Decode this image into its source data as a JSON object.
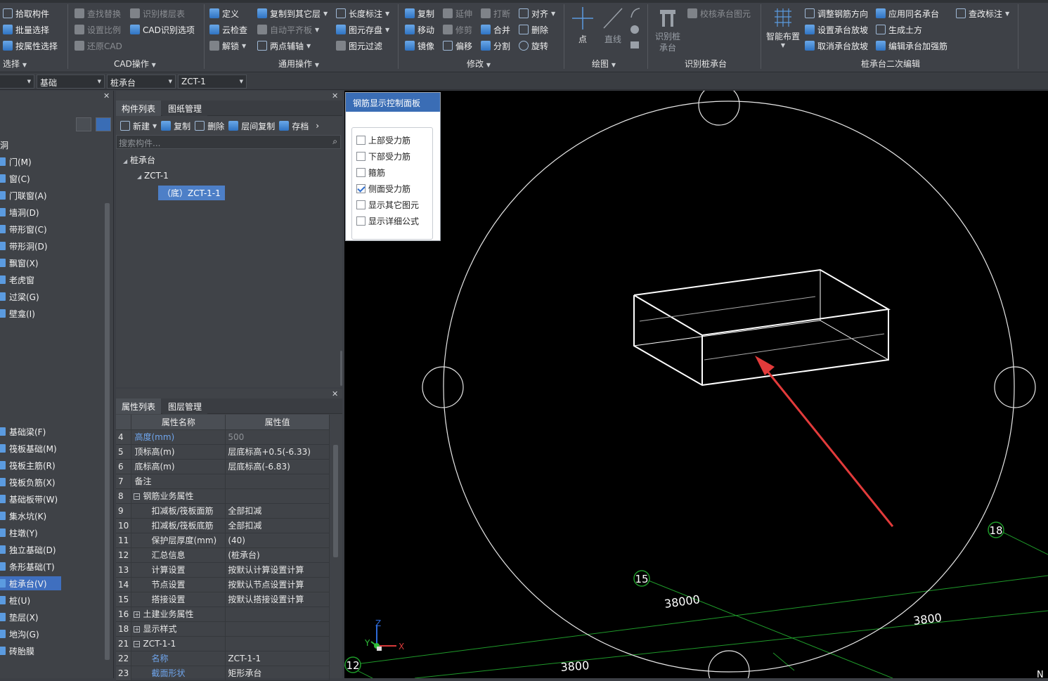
{
  "ribbon": {
    "select_group": {
      "items": [
        "拾取构件",
        "批量选择",
        "按属性选择"
      ],
      "label": "选择"
    },
    "cad_group": {
      "items": [
        "查找替换",
        "设置比例",
        "还原CAD",
        "识别楼层表",
        "CAD识别选项"
      ],
      "label": "CAD操作"
    },
    "general_group": {
      "items": [
        "定义",
        "云检查",
        "解锁",
        "复制到其它层",
        "自动平齐板",
        "两点辅轴",
        "长度标注",
        "图元存盘",
        "图元过滤"
      ],
      "label": "通用操作"
    },
    "modify_group": {
      "items": [
        "复制",
        "移动",
        "镜像",
        "延伸",
        "修剪",
        "偏移",
        "打断",
        "合并",
        "分割",
        "对齐",
        "删除",
        "旋转"
      ],
      "label": "修改"
    },
    "draw_group": {
      "items": [
        "点",
        "直线"
      ],
      "label": "绘图"
    },
    "identify_group": {
      "items": [
        "识别桩承台",
        "校核承台图元"
      ],
      "label": "识别桩承台"
    },
    "edit_group": {
      "items": [
        "智能布置",
        "调整钢筋方向",
        "设置承台放坡",
        "取消承台放坡",
        "应用同名承台",
        "生成土方",
        "编辑承台加强筋",
        "查改标注"
      ],
      "label": "桩承台二次编辑"
    }
  },
  "layerbar": {
    "combo1": "",
    "combo2": "基础",
    "combo3": "桩承台",
    "combo4": "ZCT-1"
  },
  "leftnav": {
    "header": "洞",
    "items": [
      "门(M)",
      "窗(C)",
      "门联窗(A)",
      "墙洞(D)",
      "带形窗(C)",
      "带形洞(D)",
      "飘窗(X)",
      "老虎窗",
      "过梁(G)",
      "壁龛(I)"
    ],
    "items2": [
      "基础梁(F)",
      "筏板基础(M)",
      "筏板主筋(R)",
      "筏板负筋(X)",
      "基础板带(W)",
      "集水坑(K)",
      "柱墩(Y)",
      "独立基础(D)",
      "条形基础(T)",
      "桩承台(V)",
      "桩(U)",
      "垫层(X)",
      "地沟(G)",
      "砖胎膜"
    ],
    "selected": "桩承台(V)"
  },
  "component_panel": {
    "tabs": [
      "构件列表",
      "图纸管理"
    ],
    "tools": [
      "新建",
      "复制",
      "删除",
      "层间复制",
      "存档"
    ],
    "search_placeholder": "搜索构件...",
    "tree": {
      "root": "桩承台",
      "child": "ZCT-1",
      "leaf": "（底）ZCT-1-1"
    }
  },
  "property_panel": {
    "tabs": [
      "属性列表",
      "图层管理"
    ],
    "col_name": "属性名称",
    "col_value": "属性值",
    "rows": [
      {
        "num": "4",
        "name": "高度(mm)",
        "value": "500",
        "style": "blue",
        "vstyle": "gray",
        "indent": 0,
        "pm": ""
      },
      {
        "num": "5",
        "name": "顶标高(m)",
        "value": "层底标高+0.5(-6.33)",
        "style": "",
        "vstyle": "",
        "indent": 0,
        "pm": ""
      },
      {
        "num": "6",
        "name": "底标高(m)",
        "value": "层底标高(-6.83)",
        "style": "",
        "vstyle": "",
        "indent": 0,
        "pm": ""
      },
      {
        "num": "7",
        "name": "备注",
        "value": "",
        "style": "",
        "vstyle": "",
        "indent": 0,
        "pm": ""
      },
      {
        "num": "8",
        "name": "钢筋业务属性",
        "value": "",
        "style": "",
        "vstyle": "",
        "indent": 0,
        "pm": "−"
      },
      {
        "num": "9",
        "name": "扣减板/筏板面筋",
        "value": "全部扣减",
        "style": "",
        "vstyle": "",
        "indent": 1,
        "pm": ""
      },
      {
        "num": "10",
        "name": "扣减板/筏板底筋",
        "value": "全部扣减",
        "style": "",
        "vstyle": "",
        "indent": 1,
        "pm": ""
      },
      {
        "num": "11",
        "name": "保护层厚度(mm)",
        "value": "(40)",
        "style": "",
        "vstyle": "",
        "indent": 1,
        "pm": ""
      },
      {
        "num": "12",
        "name": "汇总信息",
        "value": "(桩承台)",
        "style": "",
        "vstyle": "",
        "indent": 1,
        "pm": ""
      },
      {
        "num": "13",
        "name": "计算设置",
        "value": "按默认计算设置计算",
        "style": "",
        "vstyle": "",
        "indent": 1,
        "pm": ""
      },
      {
        "num": "14",
        "name": "节点设置",
        "value": "按默认节点设置计算",
        "style": "",
        "vstyle": "",
        "indent": 1,
        "pm": ""
      },
      {
        "num": "15",
        "name": "搭接设置",
        "value": "按默认搭接设置计算",
        "style": "",
        "vstyle": "",
        "indent": 1,
        "pm": ""
      },
      {
        "num": "16",
        "name": "土建业务属性",
        "value": "",
        "style": "",
        "vstyle": "",
        "indent": 0,
        "pm": "+"
      },
      {
        "num": "18",
        "name": "显示样式",
        "value": "",
        "style": "",
        "vstyle": "",
        "indent": 0,
        "pm": "+"
      },
      {
        "num": "21",
        "name": "ZCT-1-1",
        "value": "",
        "style": "",
        "vstyle": "",
        "indent": 0,
        "pm": "−"
      },
      {
        "num": "22",
        "name": "名称",
        "value": "ZCT-1-1",
        "style": "blue",
        "vstyle": "",
        "indent": 1,
        "pm": ""
      },
      {
        "num": "23",
        "name": "截面形状",
        "value": "矩形承台",
        "style": "blue",
        "vstyle": "",
        "indent": 1,
        "pm": ""
      }
    ]
  },
  "control_panel": {
    "title": "钢筋显示控制面板",
    "options": [
      {
        "label": "上部受力筋",
        "checked": false
      },
      {
        "label": "下部受力筋",
        "checked": false
      },
      {
        "label": "箍筋",
        "checked": false
      },
      {
        "label": "侧面受力筋",
        "checked": true
      },
      {
        "label": "显示其它图元",
        "checked": false
      },
      {
        "label": "显示详细公式",
        "checked": false
      }
    ]
  },
  "viewport": {
    "axis_labels": [
      "15",
      "18",
      "12"
    ],
    "dimensions": [
      "38000",
      "3800",
      "3800"
    ],
    "axes": {
      "x": "X",
      "y": "Y",
      "z": "Z"
    },
    "corner": "N",
    "colors": {
      "grid_line": "#1f9a2a",
      "wire": "#ffffff",
      "arrow": "#e23b3b"
    }
  }
}
